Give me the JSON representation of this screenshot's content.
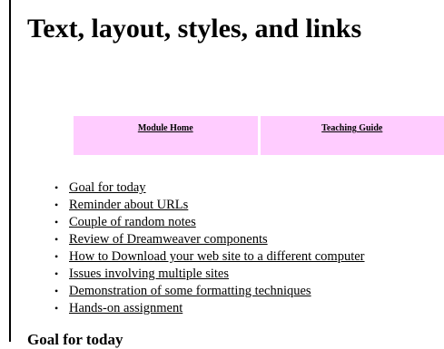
{
  "page": {
    "title": "Text, layout, styles, and links"
  },
  "nav": {
    "background": "#ffccff",
    "items": [
      {
        "label": "Module Home"
      },
      {
        "label": "Teaching Guide"
      }
    ]
  },
  "toc": {
    "items": [
      "Goal for today",
      "Reminder about URLs",
      "Couple of random notes",
      "Review of Dreamweaver components",
      "How to Download your web site to a different computer",
      "Issues involving multiple sites",
      "Demonstration of some formatting techniques",
      "Hands-on assignment"
    ]
  },
  "section": {
    "heading": "Goal for today"
  }
}
